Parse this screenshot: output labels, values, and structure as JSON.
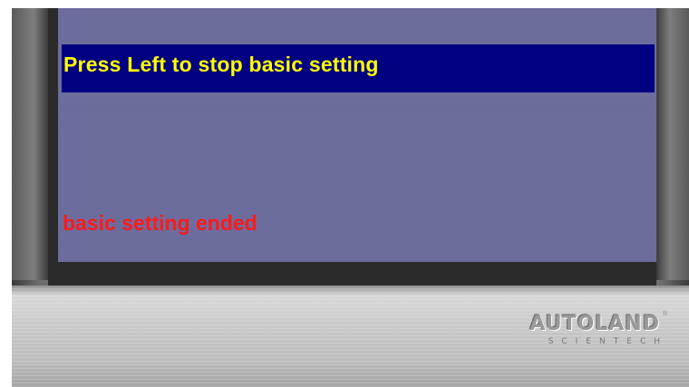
{
  "screen": {
    "prompt": "Press Left to stop basic setting",
    "status": "basic setting ended"
  },
  "brand": {
    "name": "AUTOLAND",
    "tagline": "SCIENTECH",
    "mark": "®"
  },
  "colors": {
    "screen_bg": "#6b6b9c",
    "prompt_bar": "#000080",
    "prompt_text": "#ffff00",
    "status_text": "#ff1a1a"
  }
}
